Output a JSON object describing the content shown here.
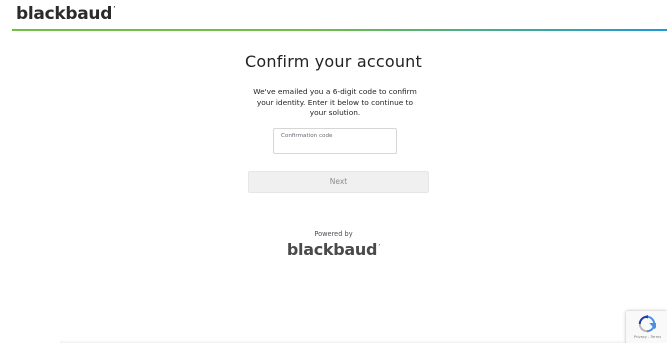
{
  "header": {
    "logo_text": "blackbaud",
    "logo_mark": "́",
    "accent_start": "#71bf44",
    "accent_end": "#1d9ad6"
  },
  "main": {
    "title": "Confirm your account",
    "description": "We've emailed you a 6-digit code to confirm your identity. Enter it below to continue to your solution.",
    "code_field": {
      "label": "Confirmation code",
      "value": ""
    },
    "next_button_label": "Next"
  },
  "footer": {
    "powered_by": "Powered by",
    "logo_text": "blackbaud"
  },
  "recaptcha": {
    "icon": "recaptcha-icon",
    "links_text": "Privacy - Terms"
  }
}
